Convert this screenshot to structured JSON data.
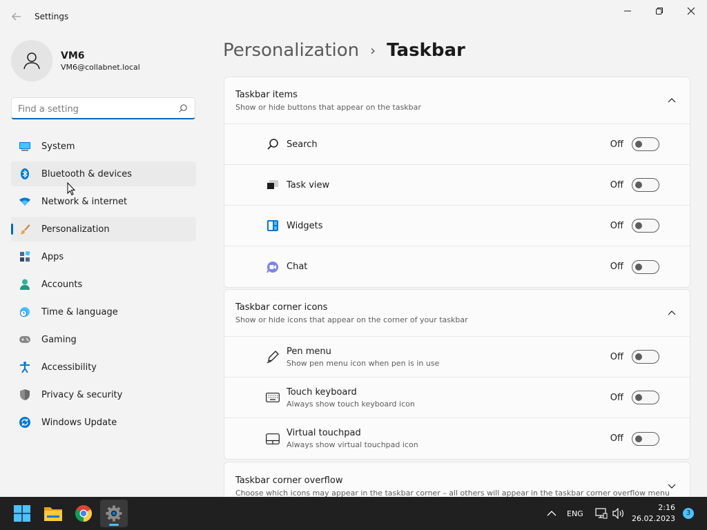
{
  "window": {
    "title": "Settings"
  },
  "user": {
    "name": "VM6",
    "email": "VM6@collabnet.local"
  },
  "search": {
    "placeholder": "Find a setting"
  },
  "sidebar": {
    "items": [
      {
        "label": "System",
        "icon": "monitor-icon"
      },
      {
        "label": "Bluetooth & devices",
        "icon": "bluetooth-icon"
      },
      {
        "label": "Network & internet",
        "icon": "wifi-icon"
      },
      {
        "label": "Personalization",
        "icon": "brush-icon"
      },
      {
        "label": "Apps",
        "icon": "apps-icon"
      },
      {
        "label": "Accounts",
        "icon": "person-icon"
      },
      {
        "label": "Time & language",
        "icon": "clock-globe-icon"
      },
      {
        "label": "Gaming",
        "icon": "gamepad-icon"
      },
      {
        "label": "Accessibility",
        "icon": "accessibility-icon"
      },
      {
        "label": "Privacy & security",
        "icon": "shield-icon"
      },
      {
        "label": "Windows Update",
        "icon": "update-icon"
      }
    ]
  },
  "breadcrumb": {
    "parent": "Personalization",
    "separator": "›",
    "current": "Taskbar"
  },
  "sections": {
    "taskbar_items": {
      "title": "Taskbar items",
      "description": "Show or hide buttons that appear on the taskbar",
      "rows": [
        {
          "label": "Search",
          "state": "Off",
          "icon": "search-icon"
        },
        {
          "label": "Task view",
          "state": "Off",
          "icon": "task-view-icon"
        },
        {
          "label": "Widgets",
          "state": "Off",
          "icon": "widgets-icon"
        },
        {
          "label": "Chat",
          "state": "Off",
          "icon": "chat-icon"
        }
      ]
    },
    "corner_icons": {
      "title": "Taskbar corner icons",
      "description": "Show or hide icons that appear on the corner of your taskbar",
      "rows": [
        {
          "label": "Pen menu",
          "sub": "Show pen menu icon when pen is in use",
          "state": "Off",
          "icon": "pen-icon"
        },
        {
          "label": "Touch keyboard",
          "sub": "Always show touch keyboard icon",
          "state": "Off",
          "icon": "keyboard-icon"
        },
        {
          "label": "Virtual touchpad",
          "sub": "Always show virtual touchpad icon",
          "state": "Off",
          "icon": "touchpad-icon"
        }
      ]
    },
    "corner_overflow": {
      "title": "Taskbar corner overflow",
      "description": "Choose which icons may appear in the taskbar corner – all others will appear in the taskbar corner overflow menu"
    }
  },
  "taskbar": {
    "tray_language": "ENG",
    "time": "2:16",
    "date": "26.02.2023",
    "notification_count": "3"
  },
  "colors": {
    "accent": "#0067c0",
    "taskbar": "#202020",
    "badge": "#4cc2ff"
  }
}
